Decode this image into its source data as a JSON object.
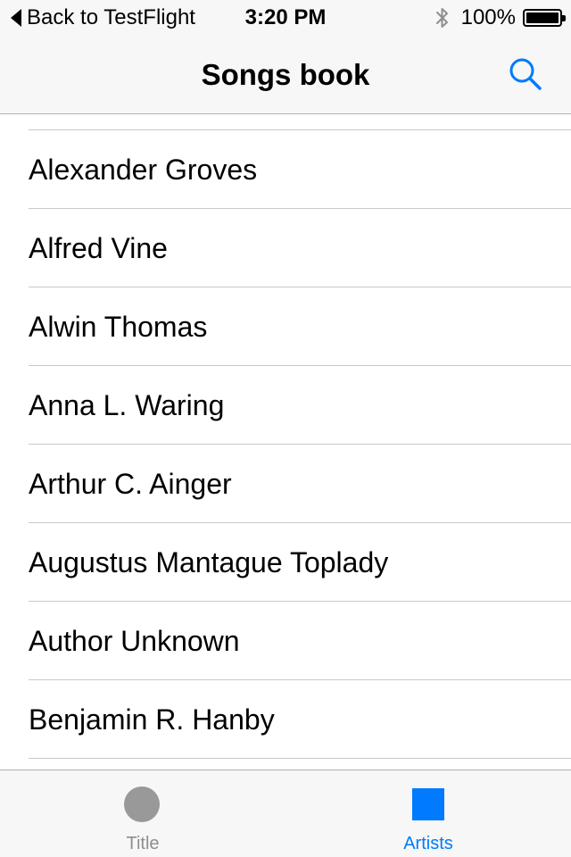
{
  "colors": {
    "accent": "#007aff",
    "inactive": "#8e8e93",
    "inactive_icon": "#999999"
  },
  "status_bar": {
    "back_label": "Back to TestFlight",
    "time": "3:20 PM",
    "battery_text": "100%",
    "battery_level": 1.0,
    "icons": [
      "back-arrow-icon",
      "bluetooth-icon",
      "battery-icon"
    ]
  },
  "nav": {
    "title": "Songs book",
    "search_icon": "search-icon"
  },
  "artists": [
    {
      "name": "Alexander Groves"
    },
    {
      "name": "Alfred Vine"
    },
    {
      "name": "Alwin Thomas"
    },
    {
      "name": "Anna L. Waring"
    },
    {
      "name": "Arthur C. Ainger"
    },
    {
      "name": "Augustus Mantague Toplady"
    },
    {
      "name": "Author Unknown"
    },
    {
      "name": "Benjamin R. Hanby"
    }
  ],
  "tabs": [
    {
      "label": "Title",
      "icon": "circle-icon",
      "selected": false
    },
    {
      "label": "Artists",
      "icon": "square-icon",
      "selected": true
    }
  ]
}
